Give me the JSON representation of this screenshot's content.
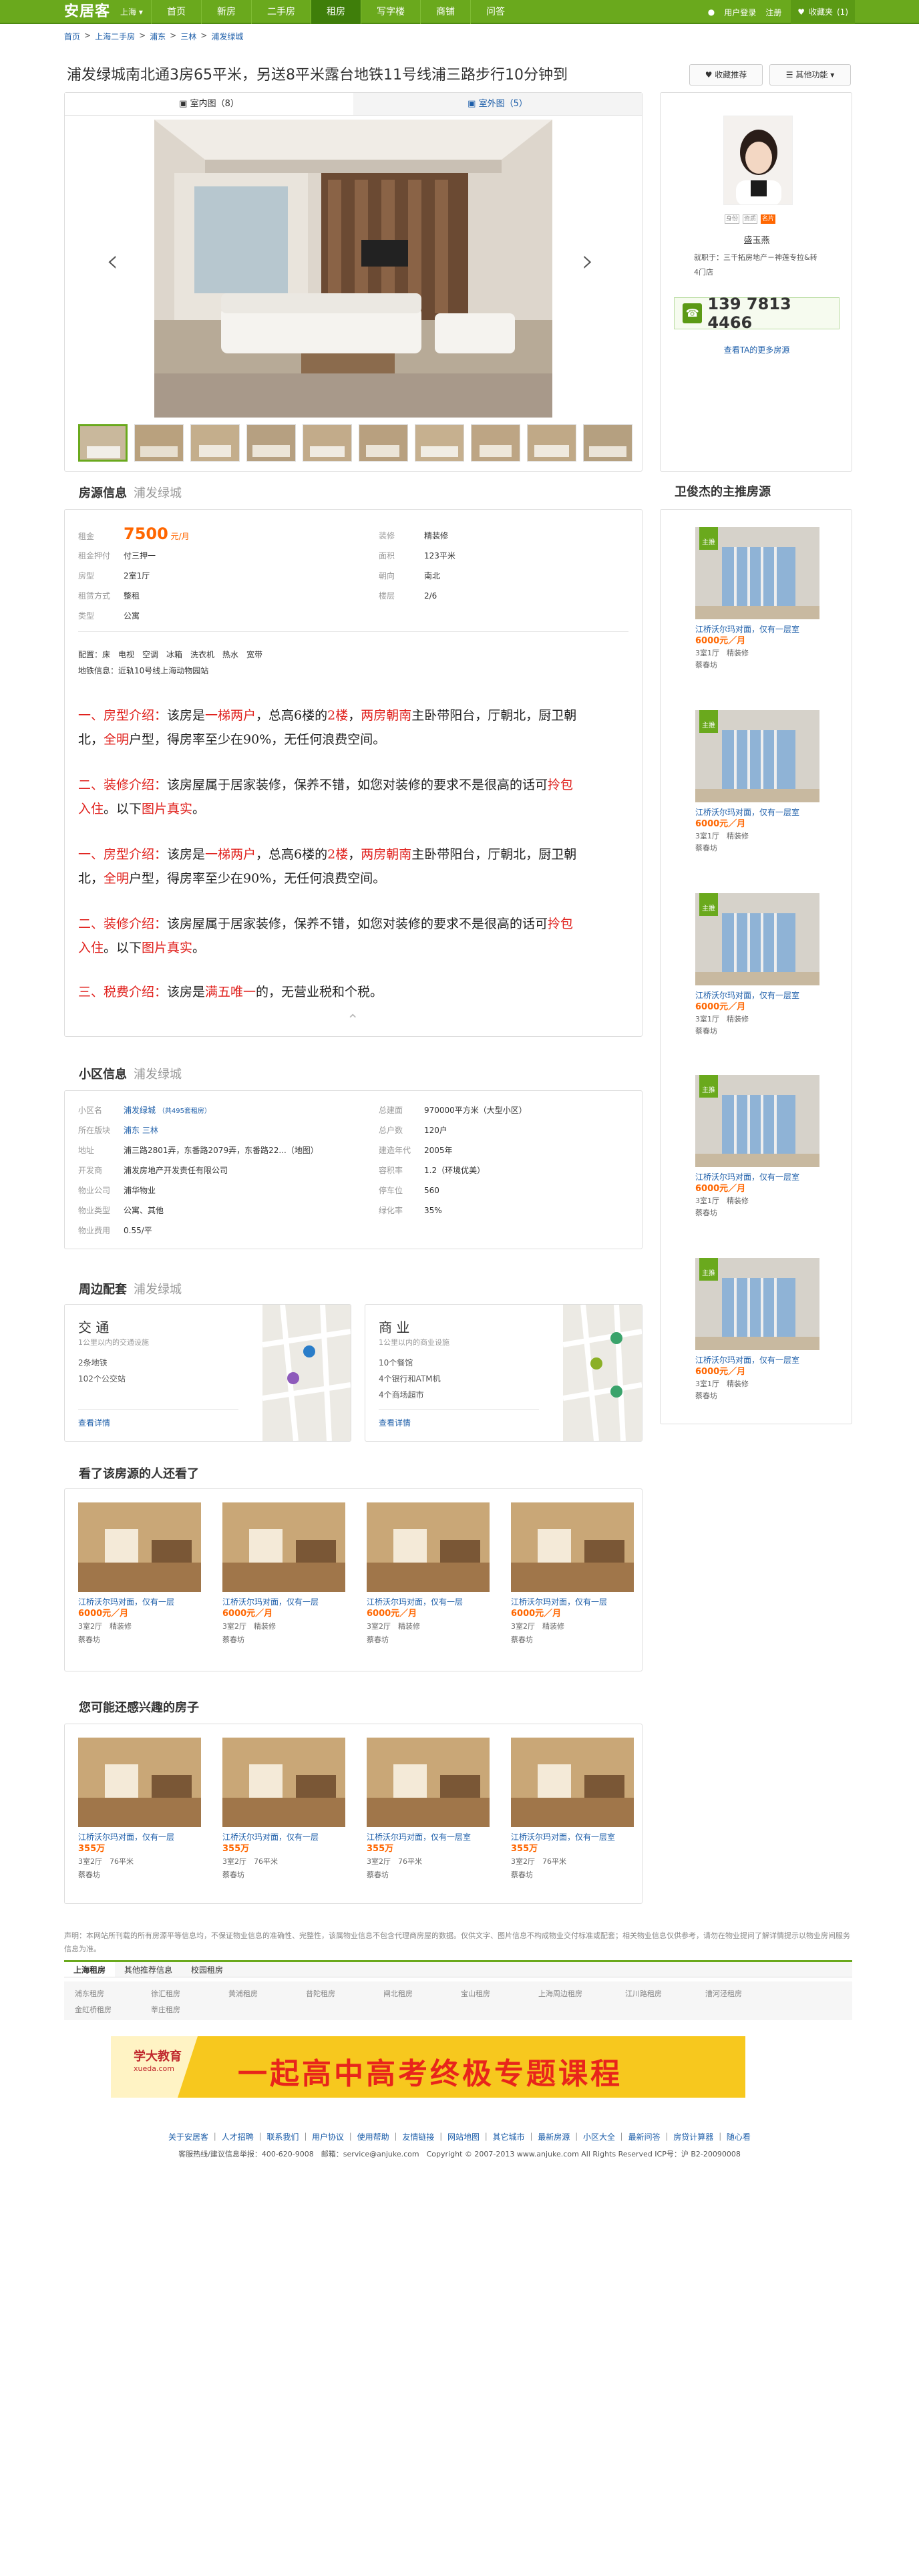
{
  "header": {
    "logo": "安居客",
    "city": "上海",
    "nav": [
      "首页",
      "新房",
      "二手房",
      "租房",
      "写字楼",
      "商铺",
      "问答"
    ],
    "nav_active": 3,
    "user": "用户登录",
    "register": "注册",
    "fav": "收藏夹",
    "fav_count": "(1)"
  },
  "breadcrumb": [
    "首页",
    "上海二手房",
    "浦东",
    "三林",
    "浦发绿城"
  ],
  "title": "浦发绿城南北通3房65平米，另送8平米露台地铁11号线浦三路步行10分钟到",
  "actions": {
    "fav": "收藏推荐",
    "more": "其他功能"
  },
  "gallery": {
    "tabs": [
      "室内图（8）",
      "室外图（5）"
    ]
  },
  "agent": {
    "name": "盛玉燕",
    "company": "就职于：三千拓房地产－神莲专拉&转4门店",
    "phone": "139 7813 4466",
    "more": "查看TA的更多房源",
    "badges": [
      "身份",
      "资质",
      "名片"
    ]
  },
  "info": {
    "heading": "房源信息",
    "sub": "浦发绿城",
    "left": [
      {
        "k": "租金",
        "v": "7500",
        "u": "元/月"
      },
      {
        "k": "租金押付",
        "v": "付三押一"
      },
      {
        "k": "房型",
        "v": "2室1厅"
      },
      {
        "k": "租赁方式",
        "v": "整租"
      },
      {
        "k": "类型",
        "v": "公寓"
      }
    ],
    "right": [
      {
        "k": "装修",
        "v": "精装修"
      },
      {
        "k": "面积",
        "v": "123平米"
      },
      {
        "k": "朝向",
        "v": "南北"
      },
      {
        "k": "楼层",
        "v": "2/6"
      }
    ],
    "config": "配置：床　电视　空调　冰箱　洗衣机　热水　宽带",
    "metro": "地铁信息：近轨10号线上海动物园站",
    "desc": [
      [
        {
          "t": "一、房型介绍：",
          "r": 1
        },
        {
          "t": "该房是"
        },
        {
          "t": "一梯两户",
          "r": 1
        },
        {
          "t": "，总高6楼的"
        },
        {
          "t": "2楼",
          "r": 1
        },
        {
          "t": "，"
        },
        {
          "t": "两房朝南",
          "r": 1
        },
        {
          "t": "主卧带阳台，厅朝北，厨卫朝北，"
        },
        {
          "t": "全明",
          "r": 1
        },
        {
          "t": "户型，得房率至少在90%，无任何浪费空间。"
        }
      ],
      [
        {
          "t": "二、装修介绍：",
          "r": 1
        },
        {
          "t": "该房屋属于居家装修，保养不错，如您对装修的要求不是很高的话可"
        },
        {
          "t": "拎包入住",
          "r": 1
        },
        {
          "t": "。以下"
        },
        {
          "t": "图片真实",
          "r": 1
        },
        {
          "t": "。"
        }
      ],
      [
        {
          "t": "一、房型介绍：",
          "r": 1
        },
        {
          "t": "该房是"
        },
        {
          "t": "一梯两户",
          "r": 1
        },
        {
          "t": "，总高6楼的"
        },
        {
          "t": "2楼",
          "r": 1
        },
        {
          "t": "，"
        },
        {
          "t": "两房朝南",
          "r": 1
        },
        {
          "t": "主卧带阳台，厅朝北，厨卫朝北，"
        },
        {
          "t": "全明",
          "r": 1
        },
        {
          "t": "户型，得房率至少在90%，无任何浪费空间。"
        }
      ],
      [
        {
          "t": "二、装修介绍：",
          "r": 1
        },
        {
          "t": "该房屋属于居家装修，保养不错，如您对装修的要求不是很高的话可"
        },
        {
          "t": "拎包入住",
          "r": 1
        },
        {
          "t": "。以下"
        },
        {
          "t": "图片真实",
          "r": 1
        },
        {
          "t": "。"
        }
      ],
      [
        {
          "t": "三、税费介绍：",
          "r": 1
        },
        {
          "t": "该房是"
        },
        {
          "t": "满五唯一",
          "r": 1
        },
        {
          "t": "的，无营业税和个税。"
        }
      ]
    ]
  },
  "community": {
    "heading": "小区信息",
    "sub": "浦发绿城",
    "left": [
      {
        "k": "小区名",
        "v": "浦发绿城",
        "x": "（共495套租房）"
      },
      {
        "k": "所在版块",
        "v": "浦东  三林"
      },
      {
        "k": "地址",
        "v": "浦三路2801弄，东番路2079弄，东番路22...（地图）"
      },
      {
        "k": "开发商",
        "v": "浦发房地产开发责任有限公司"
      },
      {
        "k": "物业公司",
        "v": "浦华物业"
      },
      {
        "k": "物业类型",
        "v": "公寓、其他"
      },
      {
        "k": "物业费用",
        "v": "0.55/平"
      }
    ],
    "right": [
      {
        "k": "总建面",
        "v": "970000平方米（大型小区）"
      },
      {
        "k": "总户数",
        "v": "120户"
      },
      {
        "k": "建造年代",
        "v": "2005年"
      },
      {
        "k": "容积率",
        "v": "1.2（环境优美）"
      },
      {
        "k": "停车位",
        "v": "560"
      },
      {
        "k": "绿化率",
        "v": "35%"
      }
    ]
  },
  "nearby": {
    "heading": "周边配套",
    "sub": "浦发绿城",
    "traffic": {
      "title": "交 通",
      "sub": "1公里以内的交通设施",
      "items": [
        "2条地铁",
        "102个公交站"
      ],
      "more": "查看详情"
    },
    "business": {
      "title": "商 业",
      "sub": "1公里以内的商业设施",
      "items": [
        "10个餐馆",
        "4个银行和ATM机",
        "4个商场超市"
      ],
      "more": "查看详情"
    }
  },
  "viewed": {
    "heading": "看了该房源的人还看了",
    "items": [
      {
        "t": "江桥沃尔玛对面，仅有一层",
        "p": "6000元／月",
        "m": "3室2厅　精装修",
        "a": "蔡春坊"
      },
      {
        "t": "江桥沃尔玛对面，仅有一层",
        "p": "6000元／月",
        "m": "3室2厅　精装修",
        "a": "蔡春坊"
      },
      {
        "t": "江桥沃尔玛对面，仅有一层",
        "p": "6000元／月",
        "m": "3室2厅　精装修",
        "a": "蔡春坊"
      },
      {
        "t": "江桥沃尔玛对面，仅有一层",
        "p": "6000元／月",
        "m": "3室2厅　精装修",
        "a": "蔡春坊"
      }
    ]
  },
  "maylike": {
    "heading": "您可能还感兴趣的房子",
    "items": [
      {
        "t": "江桥沃尔玛对面，仅有一层",
        "p": "355万",
        "m": "3室2厅　76平米",
        "a": "蔡春坊"
      },
      {
        "t": "江桥沃尔玛对面，仅有一层",
        "p": "355万",
        "m": "3室2厅　76平米",
        "a": "蔡春坊"
      },
      {
        "t": "江桥沃尔玛对面，仅有一层室",
        "p": "355万",
        "m": "3室2厅　76平米",
        "a": "蔡春坊"
      },
      {
        "t": "江桥沃尔玛对面，仅有一层室",
        "p": "355万",
        "m": "3室2厅　76平米",
        "a": "蔡春坊"
      }
    ]
  },
  "side": {
    "heading": "卫俊杰的主推房源",
    "items": [
      {
        "tag": "主推",
        "t": "江桥沃尔玛对面，仅有一层室",
        "p": "6000元／月",
        "m": "3室1厅　精装修",
        "a": "蔡春坊"
      },
      {
        "tag": "主推",
        "t": "江桥沃尔玛对面，仅有一层室",
        "p": "6000元／月",
        "m": "3室1厅　精装修",
        "a": "蔡春坊"
      },
      {
        "tag": "主推",
        "t": "江桥沃尔玛对面，仅有一层室",
        "p": "6000元／月",
        "m": "3室1厅　精装修",
        "a": "蔡春坊"
      },
      {
        "tag": "主推",
        "t": "江桥沃尔玛对面，仅有一层室",
        "p": "6000元／月",
        "m": "3室1厅　精装修",
        "a": "蔡春坊"
      },
      {
        "tag": "主推",
        "t": "江桥沃尔玛对面，仅有一层室",
        "p": "6000元／月",
        "m": "3室1厅　精装修",
        "a": "蔡春坊"
      }
    ]
  },
  "footer": {
    "disclaimer": "声明：本网站所刊载的所有房源平等信息均，不保证物业信息的准确性、完整性，该属物业信息不包含代理商房屋的数据。仅供文字、图片信息不构成物业交付标准或配套；相关物业信息仅供参考，请勿在物业提问了解详情提示以物业房间服务信息为准。",
    "tabs": [
      "上海租房",
      "其他推荐信息",
      "校园租房"
    ],
    "links": [
      "浦东租房",
      "徐汇租房",
      "黄浦租房",
      "普陀租房",
      "闸北租房",
      "宝山租房",
      "上海周边租房",
      "江川路租房",
      "漕河泾租房",
      "金虹桥租房",
      "莘庄租房"
    ],
    "banner": {
      "brand": "学大教育",
      "site": "xueda.com",
      "text": "一起高中高考终极专题课程"
    },
    "nav": [
      "关于安居客",
      "人才招聘",
      "联系我们",
      "用户协议",
      "使用帮助",
      "友情链接",
      "网站地图",
      "其它城市",
      "最新房源",
      "小区大全",
      "最新问答",
      "房贷计算器",
      "随心看"
    ],
    "copy": "客服热线/建议信息举报：400-620-9008　邮箱：service@anjuke.com　Copyright © 2007-2013 www.anjuke.com All Rights Reserved ICP号：沪 B2-20090008"
  }
}
